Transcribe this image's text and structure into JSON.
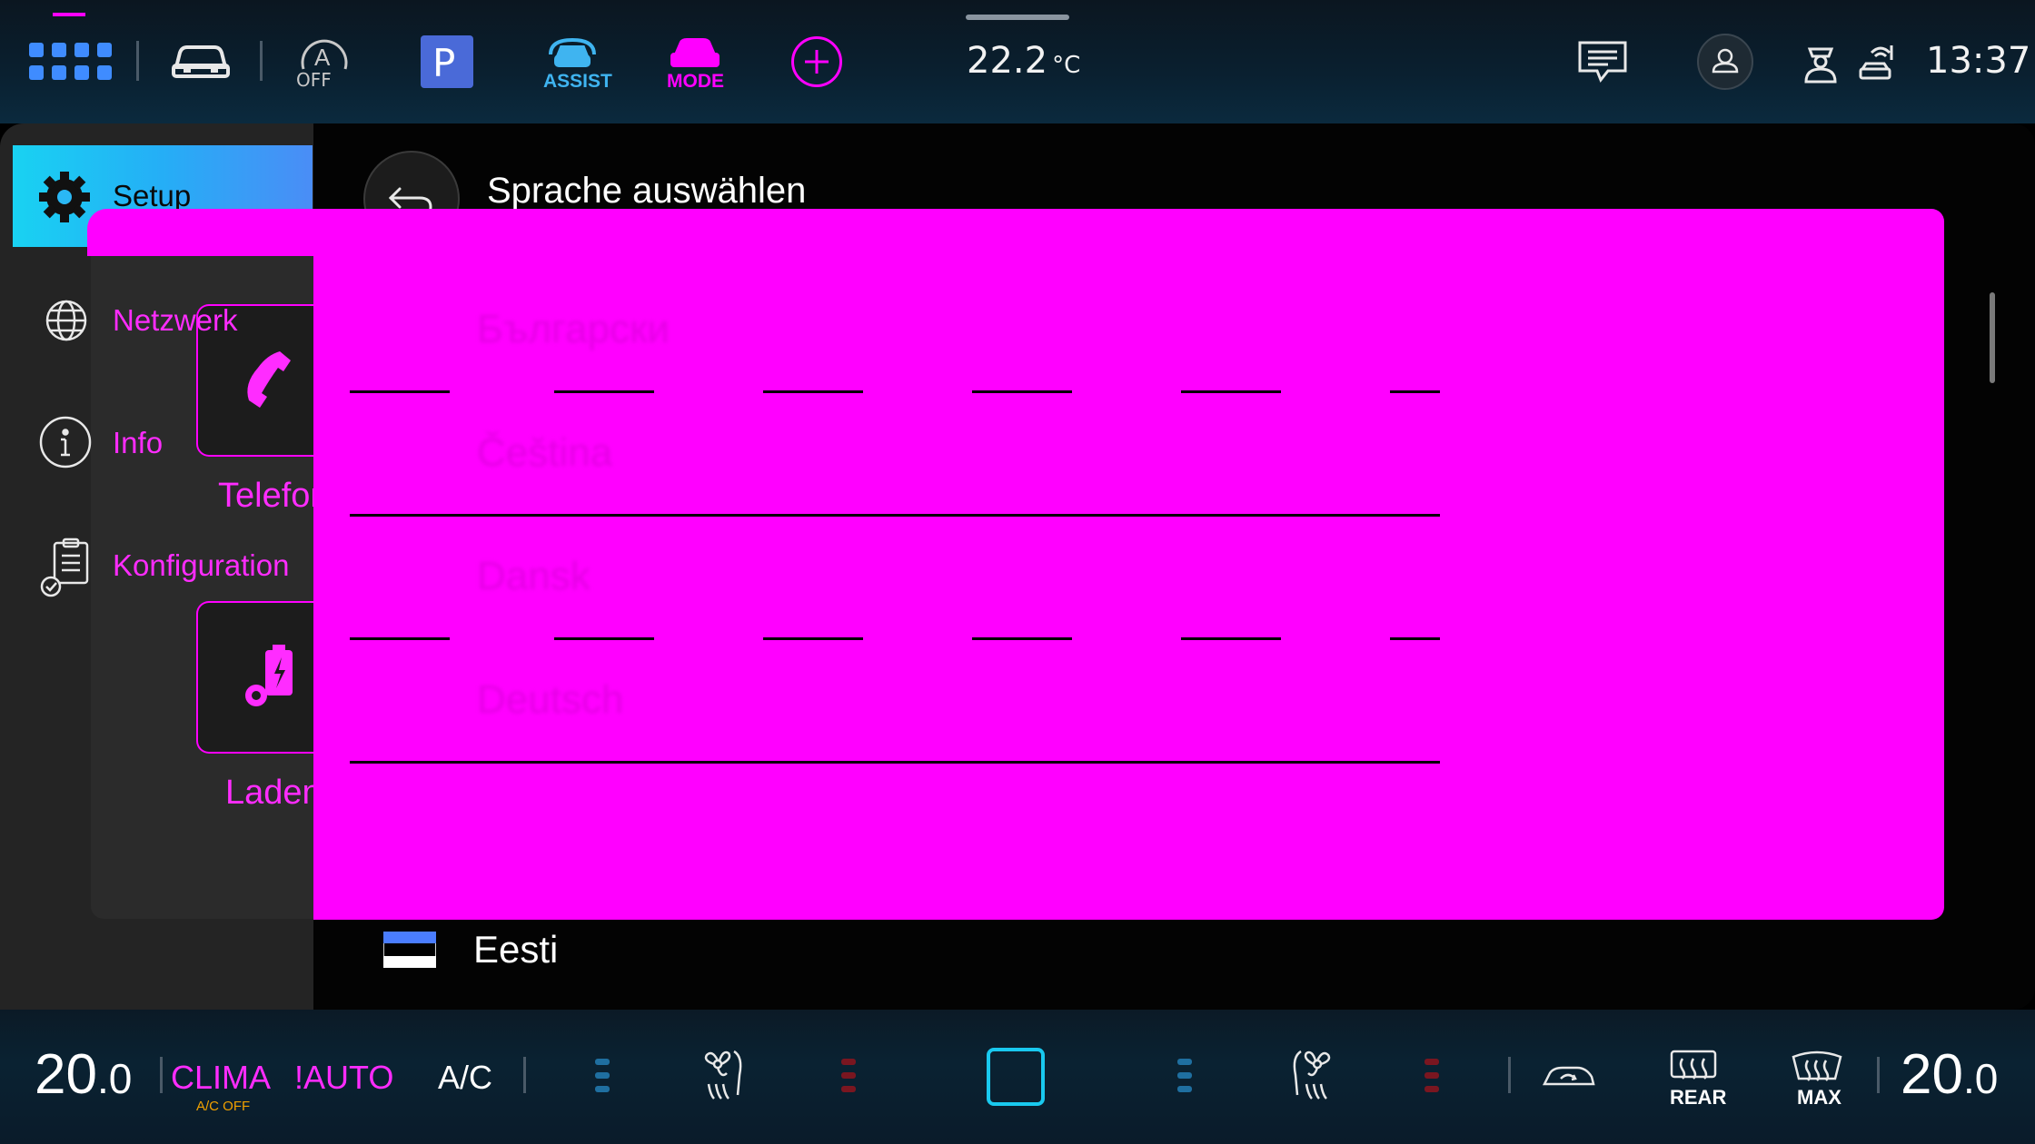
{
  "status_bar": {
    "adaptive_off_label": "OFF",
    "parking_label": "P",
    "assist_label": "ASSIST",
    "mode_label": "MODE",
    "temperature_value": "22.2",
    "temperature_unit": "°C",
    "clock": "13:37"
  },
  "sidebar": {
    "items": [
      {
        "label": "Setup",
        "icon": "gear-icon"
      },
      {
        "label": "Netzwerk",
        "icon": "globe-icon"
      },
      {
        "label": "Info",
        "icon": "info-icon"
      },
      {
        "label": "Konfiguration",
        "icon": "clipboard-check-icon"
      }
    ],
    "tiles": [
      {
        "label": "Telefon",
        "icon": "phone-icon"
      },
      {
        "label": "Laden",
        "icon": "battery-settings-icon"
      }
    ]
  },
  "page": {
    "title": "Sprache auswählen",
    "languages": [
      {
        "label": "Български"
      },
      {
        "label": "Čeština"
      },
      {
        "label": "Dansk"
      },
      {
        "label": "Deutsch"
      },
      {
        "label": "Eesti",
        "flag": "estonia"
      }
    ]
  },
  "climate": {
    "left_temp_whole": "20",
    "left_temp_decimal": ".0",
    "right_temp_whole": "20",
    "right_temp_decimal": ".0",
    "clima_label": "CLIMA",
    "ac_off_label": "A/C OFF",
    "auto_label": "!AUTO",
    "ac_label": "A/C",
    "rear_label": "REAR",
    "max_label": "MAX"
  },
  "colors": {
    "accent_cyan": "#19d2f2",
    "magenta": "#ff00ff",
    "assist_blue": "#3fb4f0",
    "ac_off_orange": "#f0a000"
  }
}
